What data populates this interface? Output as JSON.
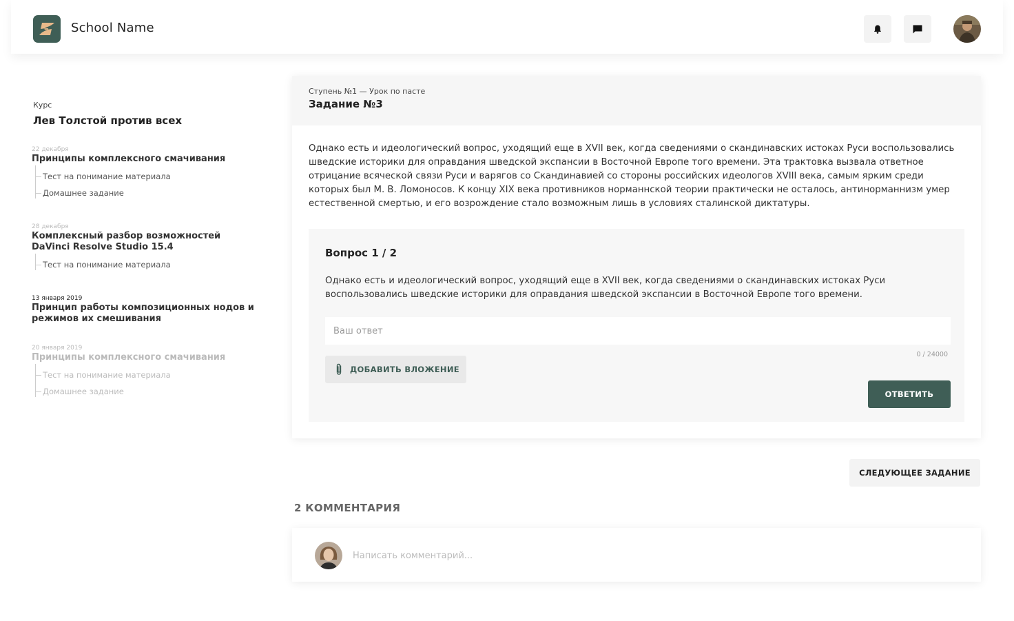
{
  "header": {
    "school_name": "School Name",
    "notifications_icon": "bell-icon",
    "messages_icon": "chat-icon",
    "brand_color": "#3f5e56"
  },
  "sidebar": {
    "course_label": "Курс",
    "course_title": "Лев Толстой против всех",
    "lessons": [
      {
        "date": "22 декабря",
        "title": "Принципы комплексного смачивания",
        "items": [
          "Тест на понимание материала",
          "Домашнее задание"
        ]
      },
      {
        "date": "28 декабря",
        "title": "Комплексный разбор возможностей DaVinci Resolve Studio 15.4",
        "items": [
          "Тест на понимание материала"
        ]
      },
      {
        "date": "13 января 2019",
        "title": "Принцип работы композиционных нодов и режимов их смешивания",
        "items": []
      },
      {
        "date": "20 января 2019",
        "title": "Принципы комплексного смачивания",
        "items": [
          "Тест на понимание материала",
          "Домашнее задание"
        ]
      }
    ]
  },
  "task": {
    "breadcrumb": "Ступень №1 — Урок по пасте",
    "title": "Задание №3",
    "text": "Однако есть и идеологический вопрос, уходящий еще в XVII век, когда сведениями о скандинавских истоках Руси воспользовались шведские историки для оправдания шведской экспансии в Восточной Европе того времени. Эта трактовка вызвала ответное отрицание всяческой связи Руси и варягов со Скандинавией со стороны российских идеологов XVIII века, самым ярким среди которых был М. В. Ломоносов. К концу XIX века противников норманнской теории практически не осталось, антинорманнизм умер естественной смертью, и его возрождение стало возможным лишь в условиях сталинской диктатуры."
  },
  "question": {
    "title": "Вопрос 1 / 2",
    "text": "Однако есть и идеологический вопрос, уходящий еще в XVII век, когда сведениями о скандинавских истоках Руси воспользовались шведские историки для оправдания шведской экспансии в Восточной Европе того времени.",
    "answer_placeholder": "Ваш ответ",
    "answer_value": "",
    "counter": "0 / 24000",
    "attach_label": "ДОБАВИТЬ ВЛОЖЕНИЕ",
    "attach_icon": "paperclip-icon",
    "reply_label": "ОТВЕТИТЬ"
  },
  "next_label": "СЛЕДУЮЩЕЕ ЗАДАНИЕ",
  "comments": {
    "title": "2 КОММЕНТАРИЯ",
    "placeholder": "Написать комментарий..."
  }
}
